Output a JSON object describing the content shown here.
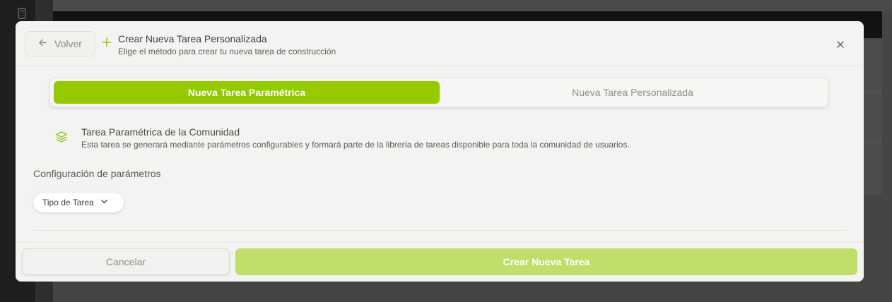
{
  "modal": {
    "back_label": "Volver",
    "title": "Crear Nueva Tarea Personalizada",
    "subtitle": "Elige el método para crear tu nueva tarea de construcción"
  },
  "tabs": [
    {
      "label": "Nueva Tarea Paramétrica",
      "active": true
    },
    {
      "label": "Nueva Tarea Personalizada",
      "active": false
    }
  ],
  "info": {
    "icon": "layers-icon",
    "title": "Tarea Paramétrica de la Comunidad",
    "description": "Esta tarea se generará mediante parámetros configurables y formará parte de la librería de tareas disponible para toda la comunidad de usuarios."
  },
  "config": {
    "section_title": "Configuración de parámetros",
    "task_type_label": "Tipo de Tarea"
  },
  "footer": {
    "cancel_label": "Cancelar",
    "create_label": "Crear Nueva Tarea"
  },
  "colors": {
    "accent": "#95c900",
    "accent_disabled": "#bfde6a",
    "icon_green": "#8fc21a"
  }
}
